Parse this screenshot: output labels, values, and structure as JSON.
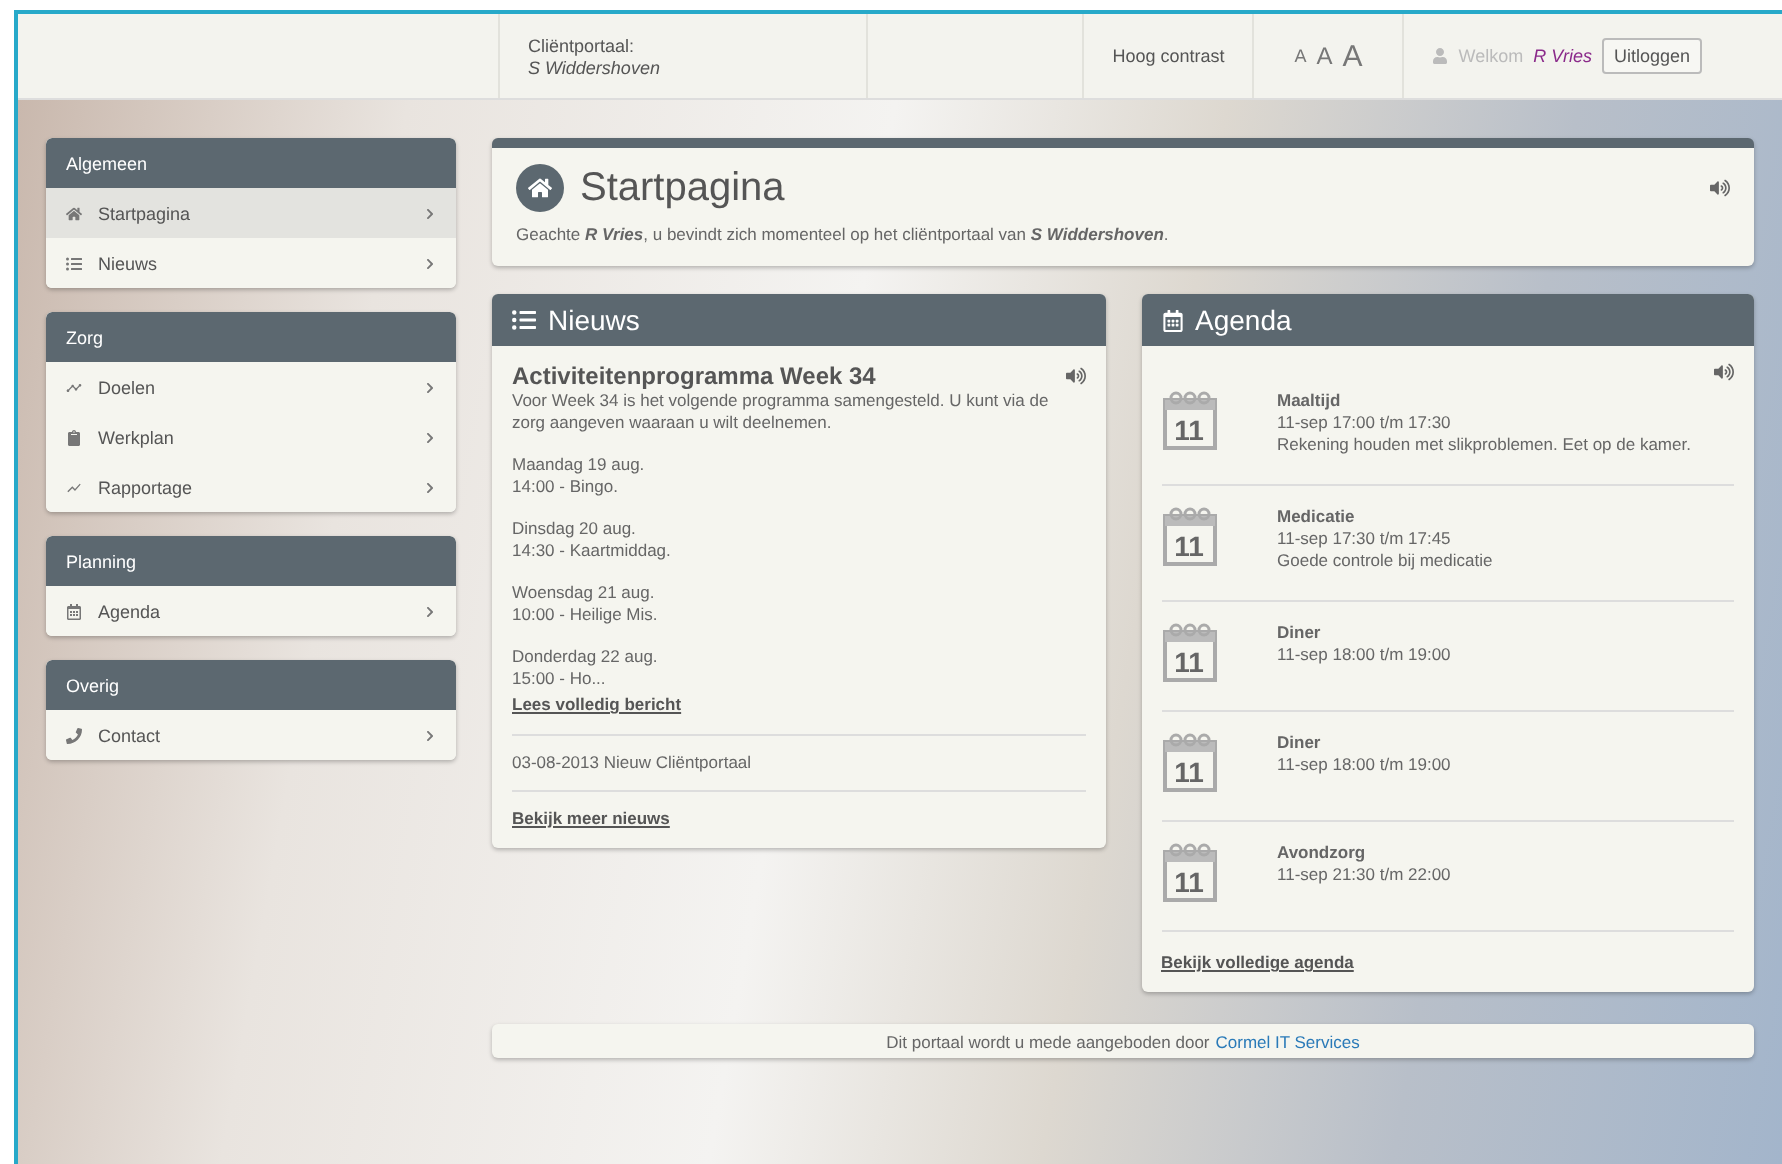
{
  "header": {
    "portal_label": "Cliëntportaal:",
    "portal_name": "S Widdershoven",
    "contrast": "Hoog contrast",
    "font_sizes": [
      "A",
      "A",
      "A"
    ],
    "welcome": "Welkom",
    "user": "R Vries",
    "logout": "Uitloggen"
  },
  "sidebar": {
    "groups": [
      {
        "title": "Algemeen",
        "items": [
          {
            "label": "Startpagina",
            "selected": true
          },
          {
            "label": "Nieuws",
            "selected": false
          }
        ]
      },
      {
        "title": "Zorg",
        "items": [
          {
            "label": "Doelen",
            "selected": false
          },
          {
            "label": "Werkplan",
            "selected": false
          },
          {
            "label": "Rapportage",
            "selected": false
          }
        ]
      },
      {
        "title": "Planning",
        "items": [
          {
            "label": "Agenda",
            "selected": false
          }
        ]
      },
      {
        "title": "Overig",
        "items": [
          {
            "label": "Contact",
            "selected": false
          }
        ]
      }
    ]
  },
  "page": {
    "title": "Startpagina",
    "greeting": "Geachte **R Vries**, u bevindt zich momenteel op het cliëntportaal van **S Widdershoven**."
  },
  "news": {
    "title": "Nieuws",
    "item_title": "Activiteitenprogramma Week 34",
    "intro": "Voor Week 34 is het volgende programma samengesteld. U kunt via de zorg aangeven waaraan u wilt deelnemen.",
    "entries": [
      {
        "day": "Maandag 19 aug.",
        "event": "14:00 - Bingo."
      },
      {
        "day": "Dinsdag 20 aug.",
        "event": "14:30 - Kaartmiddag."
      },
      {
        "day": "Woensdag 21 aug.",
        "event": "10:00 - Heilige Mis."
      },
      {
        "day": "Donderdag 22 aug.",
        "event": "15:00 - Ho..."
      }
    ],
    "read_more": "Lees volledig bericht",
    "other": [
      "03-08-2013 Nieuw Cliëntportaal"
    ],
    "more": "Bekijk meer nieuws"
  },
  "agenda": {
    "title": "Agenda",
    "items": [
      {
        "day": "11",
        "title": "Maaltijd",
        "time": "11-sep 17:00 t/m 17:30",
        "note": "Rekening houden met slikproblemen. Eet op de kamer."
      },
      {
        "day": "11",
        "title": "Medicatie",
        "time": "11-sep 17:30 t/m 17:45",
        "note": "Goede controle bij medicatie"
      },
      {
        "day": "11",
        "title": "Diner",
        "time": "11-sep 18:00 t/m 19:00"
      },
      {
        "day": "11",
        "title": "Diner",
        "time": "11-sep 18:00 t/m 19:00"
      },
      {
        "day": "11",
        "title": "Avondzorg",
        "time": "11-sep 21:30 t/m 22:00"
      }
    ],
    "more": "Bekijk volledige agenda"
  },
  "footer": {
    "text": "Dit portaal wordt u mede aangeboden door",
    "link": "Cormel IT Services"
  }
}
